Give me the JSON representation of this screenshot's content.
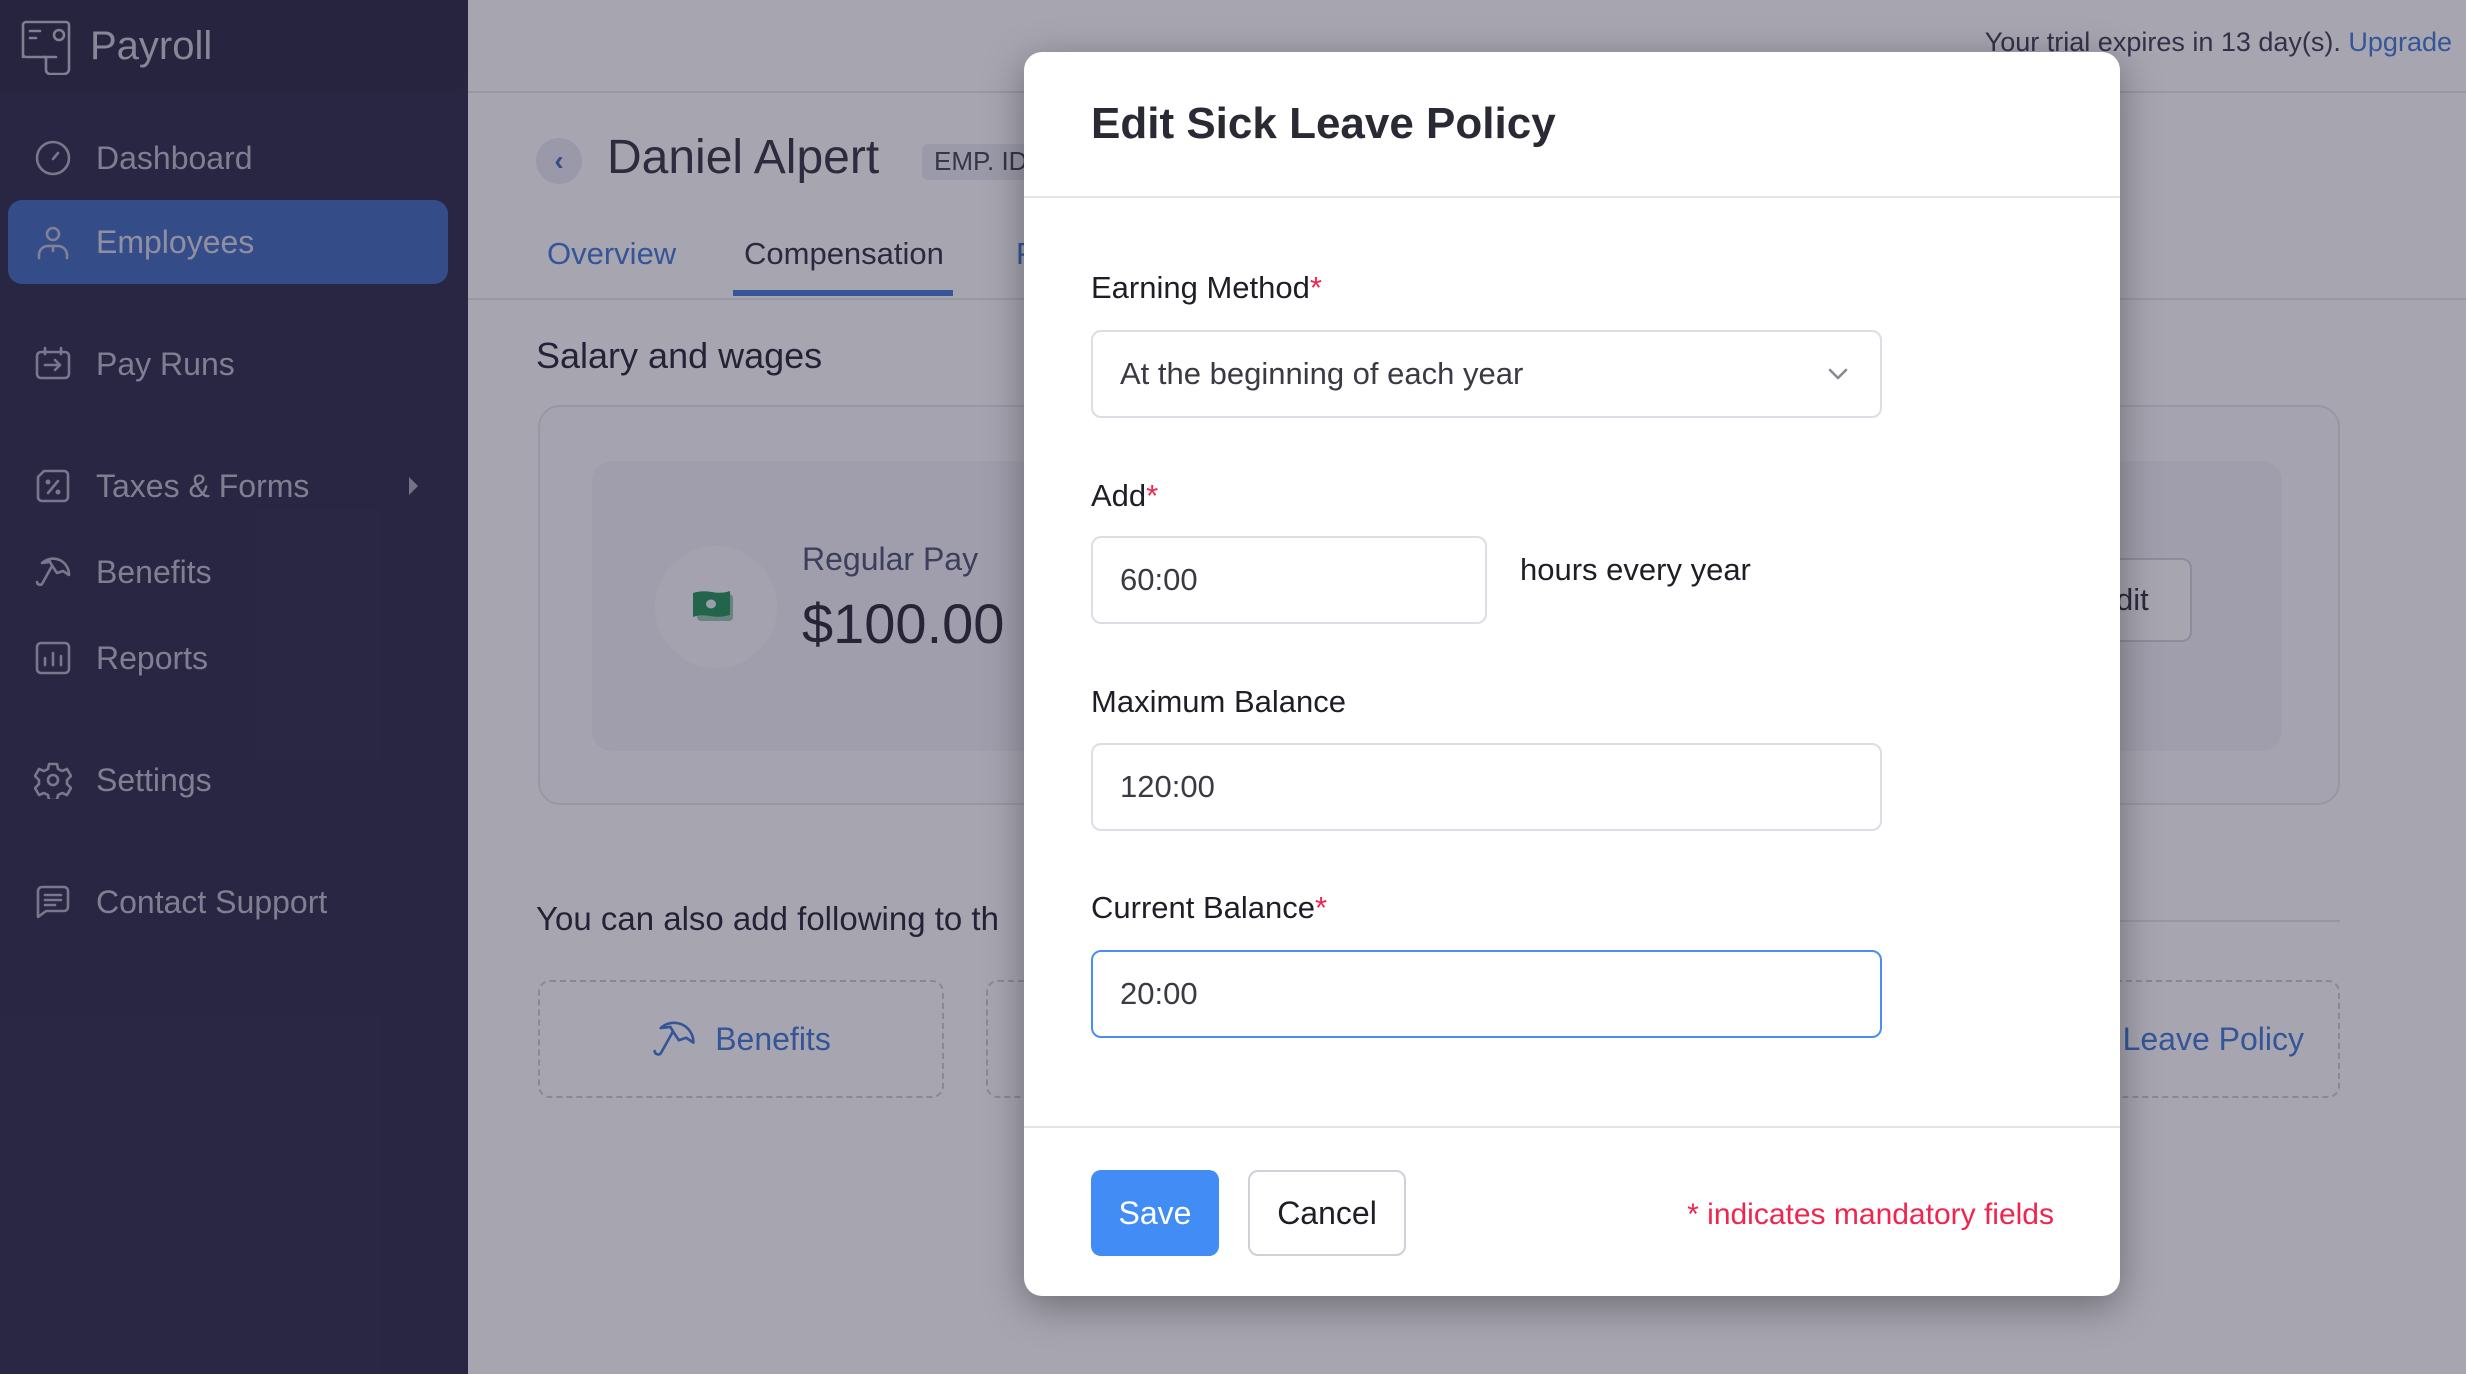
{
  "app": {
    "name": "Payroll",
    "brand_icon": "payroll-logo-icon"
  },
  "sidebar": {
    "items": [
      {
        "label": "Dashboard",
        "icon": "dashboard-gauge-icon",
        "active": false
      },
      {
        "label": "Employees",
        "icon": "user-icon",
        "active": true
      },
      {
        "label": "Pay Runs",
        "icon": "calendar-arrow-icon",
        "active": false
      },
      {
        "label": "Taxes & Forms",
        "icon": "percent-tag-icon",
        "active": false,
        "has_submenu": true
      },
      {
        "label": "Benefits",
        "icon": "umbrella-icon",
        "active": false
      },
      {
        "label": "Reports",
        "icon": "bar-chart-icon",
        "active": false
      },
      {
        "label": "Settings",
        "icon": "gear-icon",
        "active": false
      },
      {
        "label": "Contact Support",
        "icon": "chat-icon",
        "active": false
      }
    ]
  },
  "topbar": {
    "trial_text": "Your trial expires in 13 day(s).",
    "upgrade_label": "Upgrade"
  },
  "employee": {
    "name": "Daniel Alpert",
    "id_badge": "EMP. ID"
  },
  "tabs": [
    {
      "label": "Overview",
      "active": false
    },
    {
      "label": "Compensation",
      "active": true
    },
    {
      "label": "P",
      "active": false
    }
  ],
  "salary": {
    "section_title": "Salary and wages",
    "pay_label": "Regular Pay",
    "pay_amount": "$100.00",
    "edit_label": "Edit"
  },
  "add_more": {
    "heading": "You can also add following to th",
    "items": [
      {
        "label": "Benefits",
        "icon": "umbrella-icon"
      },
      {
        "label": "",
        "icon": ""
      },
      {
        "label": "Leave Policy",
        "icon": ""
      }
    ]
  },
  "modal": {
    "title": "Edit Sick Leave Policy",
    "fields": {
      "earning_method": {
        "label": "Earning Method",
        "required": true,
        "value": "At the beginning of each year"
      },
      "add": {
        "label": "Add",
        "required": true,
        "value": "60:00",
        "suffix": "hours every year"
      },
      "maximum_balance": {
        "label": "Maximum Balance",
        "required": false,
        "value": "120:00"
      },
      "current_balance": {
        "label": "Current Balance",
        "required": true,
        "value": "20:00"
      }
    },
    "required_marker": "*",
    "save_label": "Save",
    "cancel_label": "Cancel",
    "mandatory_note": "* indicates mandatory fields"
  },
  "colors": {
    "sidebar_bg": "#19193a",
    "active_nav": "#2f5fb6",
    "accent_blue": "#2f6fd6",
    "save_button": "#418df5",
    "required_red": "#f0244e",
    "money_green": "#0f8a4a"
  }
}
